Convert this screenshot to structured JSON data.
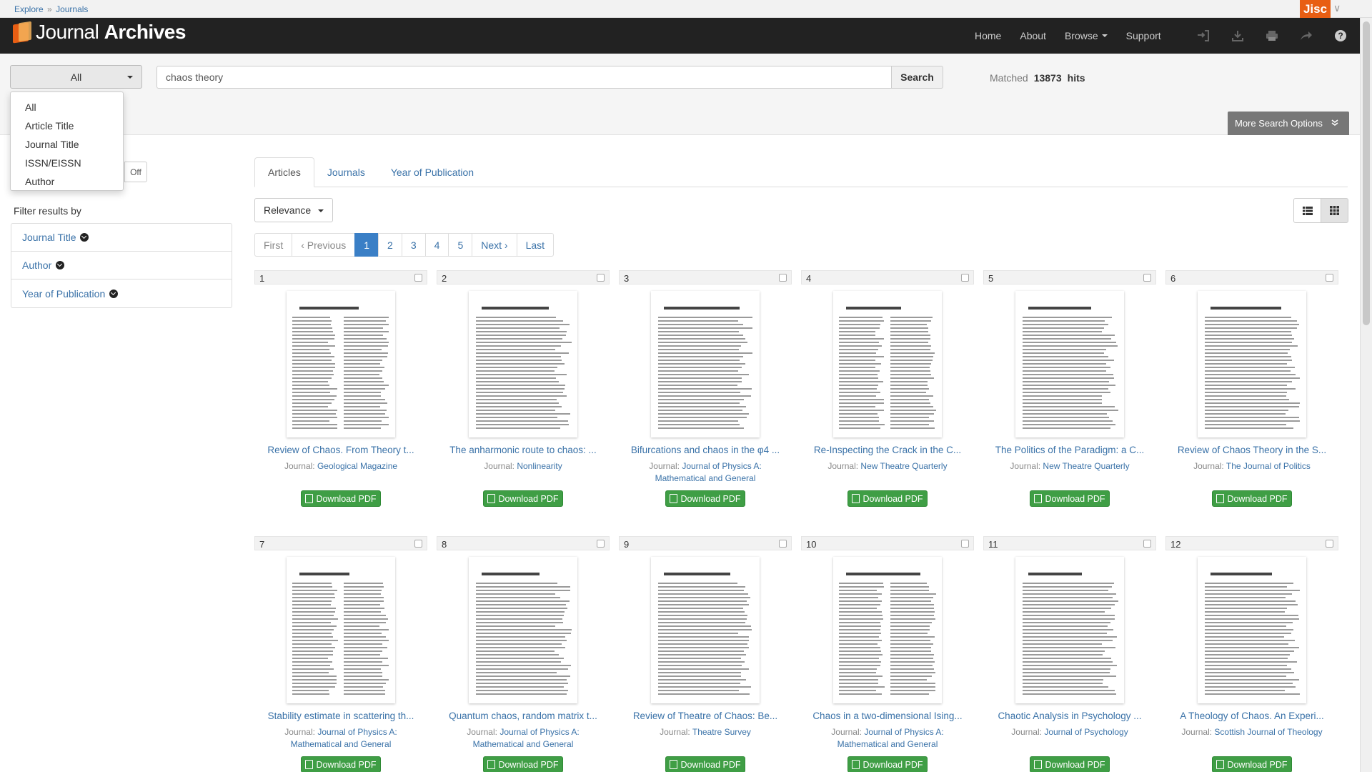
{
  "breadcrumb": {
    "root": "Explore",
    "separator": "»",
    "current": "Journals"
  },
  "brand": {
    "jisc": "Jisc",
    "logo_light": "Journal ",
    "logo_bold": "Archives"
  },
  "nav": {
    "home": "Home",
    "about": "About",
    "browse": "Browse",
    "support": "Support"
  },
  "search": {
    "field_selected": "All",
    "field_options": [
      "All",
      "Article Title",
      "Journal Title",
      "ISSN/EISSN",
      "Author"
    ],
    "query": "chaos theory",
    "button": "Search",
    "matched_label": "Matched",
    "matched_count": "13873",
    "hits_label": "hits",
    "more_options": "More Search Options",
    "toggle_off": "Off"
  },
  "filters": {
    "title": "Filter results by",
    "items": [
      "Journal Title",
      "Author",
      "Year of Publication"
    ]
  },
  "tabs": [
    "Articles",
    "Journals",
    "Year of Publication"
  ],
  "sort": {
    "selected": "Relevance"
  },
  "pagination": {
    "first": "First",
    "previous": "‹ Previous",
    "pages": [
      "1",
      "2",
      "3",
      "4",
      "5"
    ],
    "next": "Next ›",
    "last": "Last",
    "current": "1"
  },
  "download_label": "Download PDF",
  "journal_label": "Journal:",
  "results": [
    {
      "num": "1",
      "title": "Review of Chaos. From Theory t...",
      "journal": "Geological Magazine"
    },
    {
      "num": "2",
      "title": "The anharmonic route to chaos: ...",
      "journal": "Nonlinearity"
    },
    {
      "num": "3",
      "title": "Bifurcations and chaos in the φ4 ...",
      "journal": "Journal of Physics A: Mathematical and General"
    },
    {
      "num": "4",
      "title": "Re-Inspecting the Crack in the C...",
      "journal": "New Theatre Quarterly"
    },
    {
      "num": "5",
      "title": "The Politics of the Paradigm: a C...",
      "journal": "New Theatre Quarterly"
    },
    {
      "num": "6",
      "title": "Review of Chaos Theory in the S...",
      "journal": "The Journal of Politics"
    },
    {
      "num": "7",
      "title": "Stability estimate in scattering th...",
      "journal": "Journal of Physics A: Mathematical and General"
    },
    {
      "num": "8",
      "title": "Quantum chaos, random matrix t...",
      "journal": "Journal of Physics A: Mathematical and General"
    },
    {
      "num": "9",
      "title": "Review of Theatre of Chaos: Be...",
      "journal": "Theatre Survey"
    },
    {
      "num": "10",
      "title": "Chaos in a two-dimensional Ising...",
      "journal": "Journal of Physics A: Mathematical and General"
    },
    {
      "num": "11",
      "title": "Chaotic Analysis in Psychology ...",
      "journal": "Journal of Psychology"
    },
    {
      "num": "12",
      "title": "A Theology of Chaos. An Experi...",
      "journal": "Scottish Journal of Theology"
    }
  ],
  "colors": {
    "navbar": "#222222",
    "link": "#3a72a8",
    "accent": "#3a7fc6",
    "download": "#3f9e45",
    "jisc": "#e85e13"
  }
}
